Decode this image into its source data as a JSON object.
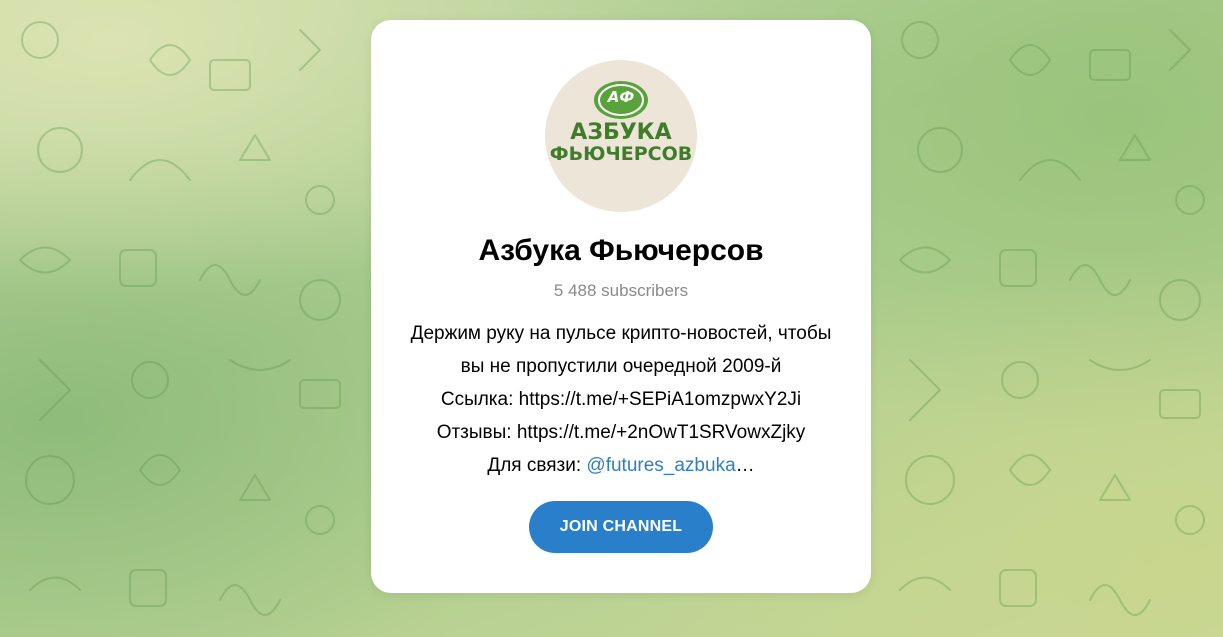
{
  "channel": {
    "title": "Азбука Фьючерсов",
    "subscribers": "5 488 subscribers",
    "description_lines": [
      "Держим руку на пульсе крипто-новостей, чтобы",
      "вы не пропустили очередной 2009-й",
      "Ссылка: https://t.me/+SEPiA1omzpwxY2Ji",
      "Отзывы: https://t.me/+2nOwT1SRVowxZjky"
    ],
    "contact_prefix": "Для связи: ",
    "contact_mention": "@futures_azbuka",
    "contact_suffix": "…"
  },
  "avatar": {
    "monogram": "АФ",
    "line1": "АЗБУКА",
    "line2": "ФЬЮЧЕРСОВ",
    "bg_color": "#ede5d8",
    "brand_color": "#3f7d2a"
  },
  "actions": {
    "join_label": "JOIN CHANNEL",
    "join_color": "#2a7fcb"
  },
  "background": {
    "pattern_icon": "doodle-pattern"
  }
}
